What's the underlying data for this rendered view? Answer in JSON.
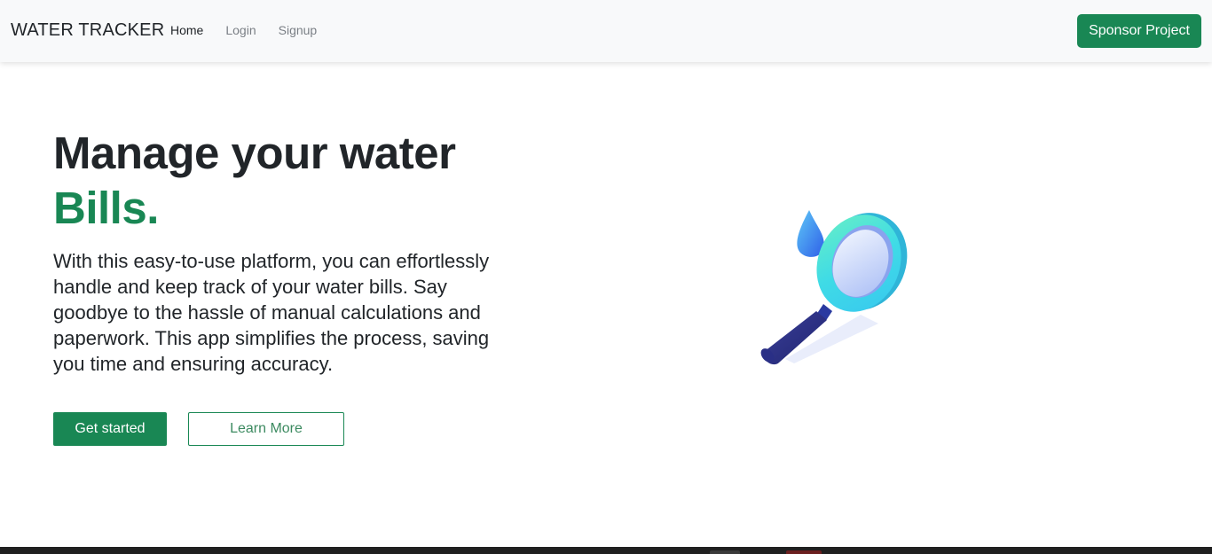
{
  "navbar": {
    "brand": "WATER TRACKER",
    "links": [
      {
        "label": "Home",
        "active": true
      },
      {
        "label": "Login",
        "active": false
      },
      {
        "label": "Signup",
        "active": false
      }
    ],
    "sponsor_label": "Sponsor Project"
  },
  "hero": {
    "title_line1": "Manage your water",
    "title_line2": "Bills.",
    "description": "With this easy-to-use platform, you can effortlessly handle and keep track of your water bills. Say goodbye to the hassle of manual calculations and paperwork. This app simplifies the process, saving you time and ensuring accuracy.",
    "primary_button": "Get started",
    "secondary_button": "Learn More",
    "illustration_icon": "magnifying-glass-water-drop"
  },
  "colors": {
    "accent": "#198754",
    "navbar_bg": "#f8f9fa",
    "text": "#212529",
    "taskbar": "#202020"
  }
}
